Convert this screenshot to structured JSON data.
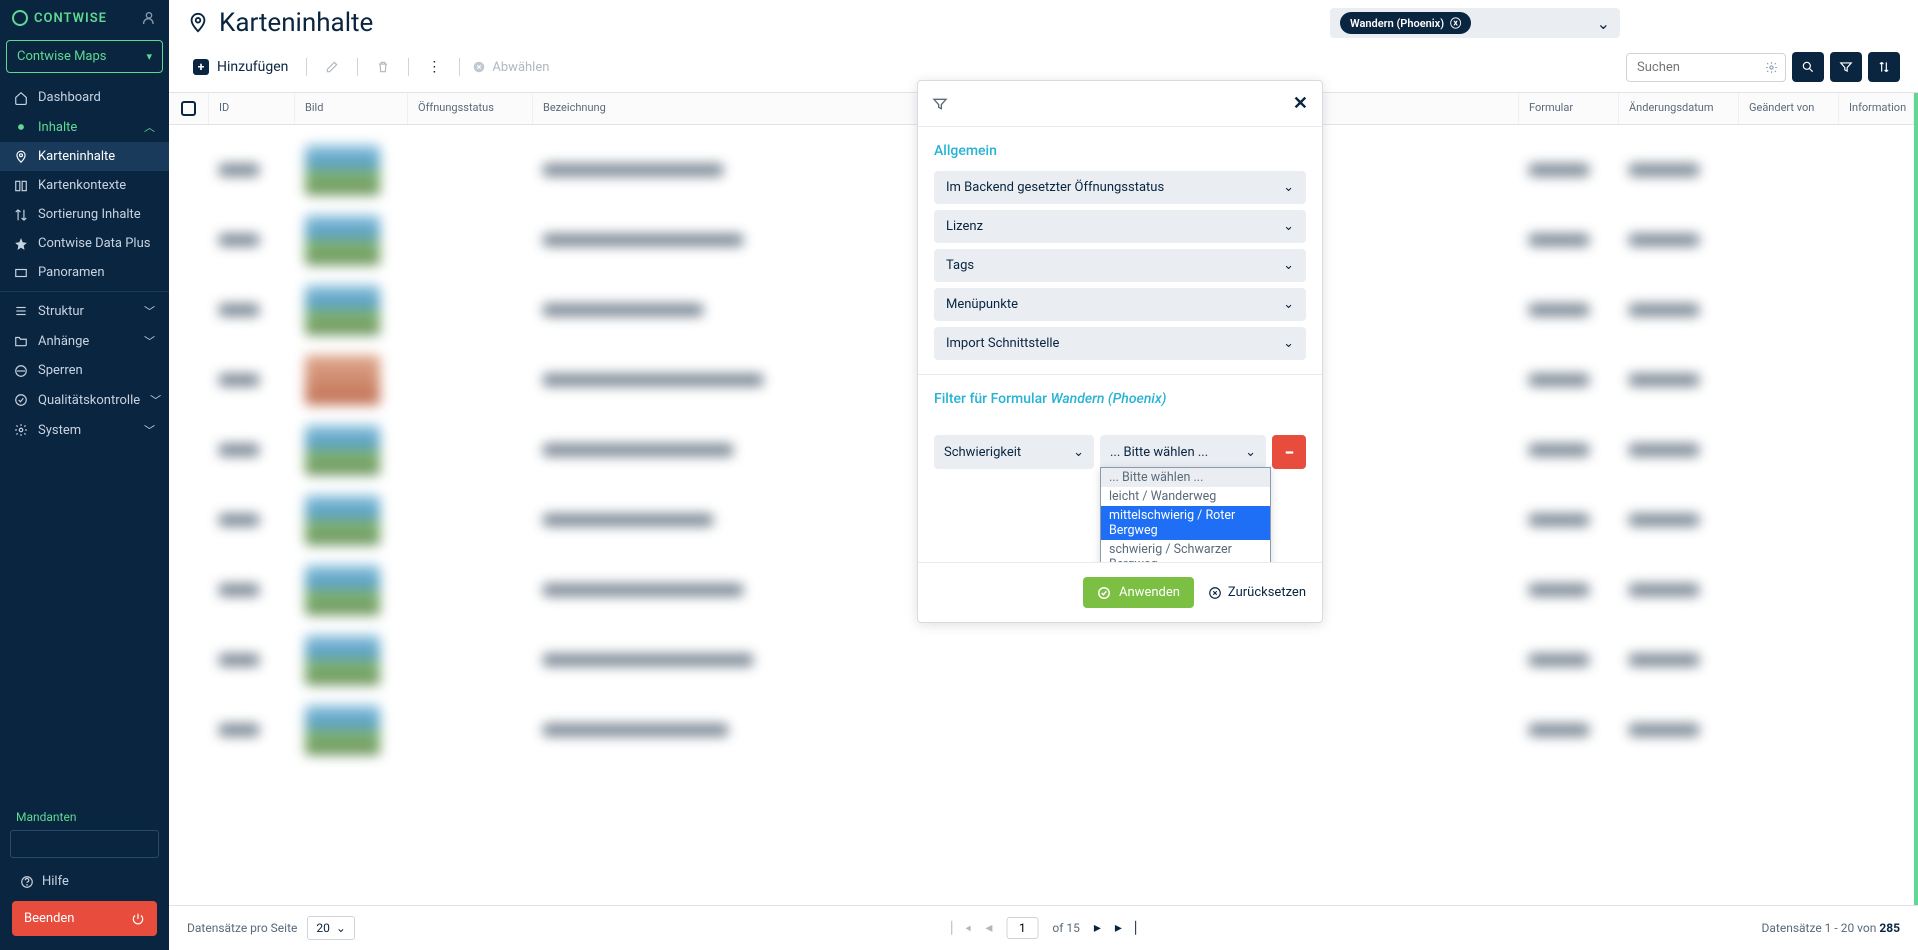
{
  "brand": "CONTWISE",
  "workspace": "Contwise Maps",
  "nav": {
    "dashboard": "Dashboard",
    "inhalte": "Inhalte",
    "karteninhalte": "Karteninhalte",
    "kartenkontexte": "Kartenkontexte",
    "sortierung": "Sortierung Inhalte",
    "dataplus": "Contwise Data Plus",
    "panoramen": "Panoramen",
    "struktur": "Struktur",
    "anhaenge": "Anhänge",
    "sperren": "Sperren",
    "qk": "Qualitätskontrolle",
    "system": "System"
  },
  "mandanten_label": "Mandanten",
  "help": "Hilfe",
  "exit": "Beenden",
  "page_title": "Karteninhalte",
  "tag": "Wandern (Phoenix)",
  "toolbar": {
    "add": "Hinzufügen",
    "deselect": "Abwählen",
    "search_placeholder": "Suchen"
  },
  "columns": {
    "id": "ID",
    "bild": "Bild",
    "status": "Öffnungsstatus",
    "bezeichnung": "Bezeichnung",
    "formular": "Formular",
    "aenderungsdatum": "Änderungsdatum",
    "geaendert_von": "Geändert von",
    "information": "Information"
  },
  "footer": {
    "per_page_label": "Datensätze pro Seite",
    "per_page_value": "20",
    "page": "1",
    "of_label": "of 15",
    "records_prefix": "Datensätze 1 - 20 von ",
    "records_total": "285"
  },
  "filter": {
    "section_general": "Allgemein",
    "acc_status": "Im Backend gesetzter Öffnungsstatus",
    "acc_lizenz": "Lizenz",
    "acc_tags": "Tags",
    "acc_menu": "Menüpunkte",
    "acc_import": "Import Schnittstelle",
    "section_form_prefix": "Filter für Formular ",
    "section_form_italic": "Wandern (Phoenix)",
    "schwierigkeit": "Schwierigkeit",
    "placeholder": "... Bitte wählen ...",
    "opt_leicht": "leicht / Wanderweg",
    "opt_mittel": "mittelschwierig / Roter Bergweg",
    "opt_schwer": "schwierig / Schwarzer Bergweg",
    "apply": "Anwenden",
    "reset": "Zurücksetzen"
  }
}
